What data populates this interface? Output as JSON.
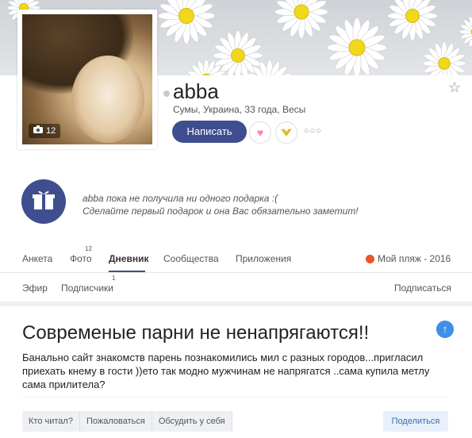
{
  "profile": {
    "username": "abba",
    "meta": "Сумы, Украина, 33 года, Весы",
    "photo_count": "12",
    "write_label": "Написать"
  },
  "gifts": {
    "line1": "abba пока не получила ни одного подарка :(",
    "line2": "Сделайте первый подарок и она Вас обязательно заметит!"
  },
  "tabs": [
    {
      "label": "Анкета"
    },
    {
      "label": "Фото",
      "count": "12"
    },
    {
      "label": "Дневник",
      "active": true
    },
    {
      "label": "Сообщества"
    },
    {
      "label": "Приложения"
    }
  ],
  "beach_label": "Мой пляж - 2016",
  "subtabs": [
    {
      "label": "Эфир"
    },
    {
      "label": "Подписчики",
      "count": "1"
    }
  ],
  "subscribe_label": "Подписаться",
  "post": {
    "title": "Совремeные парни не ненапрягаются!!",
    "text": "Банально сайт знакомств парень познакомились мил с разных городов...пригласил приехать кнему в гости ))ето так модно мужчинам не напрягатся ..сама купила метлу сама прилитела?"
  },
  "actions": [
    "Кто читал?",
    "Пожаловаться",
    "Обсудить у себя"
  ],
  "share_label": "Поделиться",
  "colors": {
    "accent": "#3f4e8e",
    "up": "#3d8fe8"
  }
}
